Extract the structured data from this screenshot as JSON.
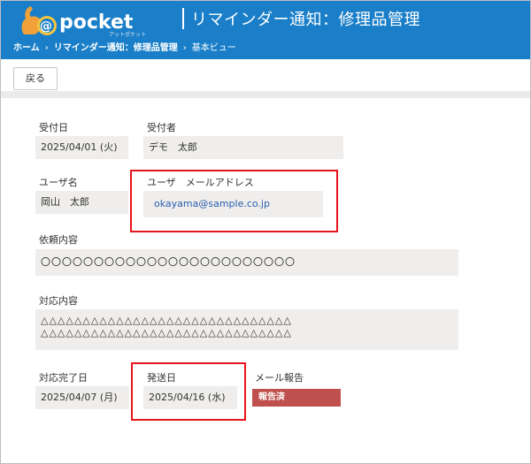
{
  "header": {
    "brand_at": "@",
    "brand_name": "pocket",
    "brand_tagline": "アットポケット",
    "title": "リマインダー通知：修理品管理"
  },
  "breadcrumb": {
    "items": [
      "ホーム",
      "リマインダー通知：修理品管理",
      "基本ビュー"
    ],
    "separator": "›"
  },
  "toolbar": {
    "back_label": "戻る"
  },
  "form": {
    "received_date": {
      "label": "受付日",
      "value": "2025/04/01 (火)"
    },
    "receiver": {
      "label": "受付者",
      "value": "デモ　太郎"
    },
    "user_name": {
      "label": "ユーザ名",
      "value": "岡山　太郎"
    },
    "user_email": {
      "label": "ユーザ　メールアドレス",
      "value": "okayama@sample.co.jp"
    },
    "request": {
      "label": "依頼内容",
      "value": "〇〇〇〇〇〇〇〇〇〇〇〇〇〇〇〇〇〇〇〇〇〇〇〇"
    },
    "response": {
      "label": "対応内容",
      "line1": "△△△△△△△△△△△△△△△△△△△△△△△△△△△△△△",
      "line2": "△△△△△△△△△△△△△△△△△△△△△△△△△△△△△△"
    },
    "completion_date": {
      "label": "対応完了日",
      "value": "2025/04/07 (月)"
    },
    "ship_date": {
      "label": "発送日",
      "value": "2025/04/16 (水)"
    },
    "mail_report": {
      "label": "メール報告",
      "value": "報告済"
    }
  },
  "colors": {
    "header_blue": "#1a7fc8",
    "field_bg": "#efeeec",
    "badge_red": "#c0504d",
    "highlight_red": "#e8141b",
    "link_blue": "#2a5db0"
  }
}
